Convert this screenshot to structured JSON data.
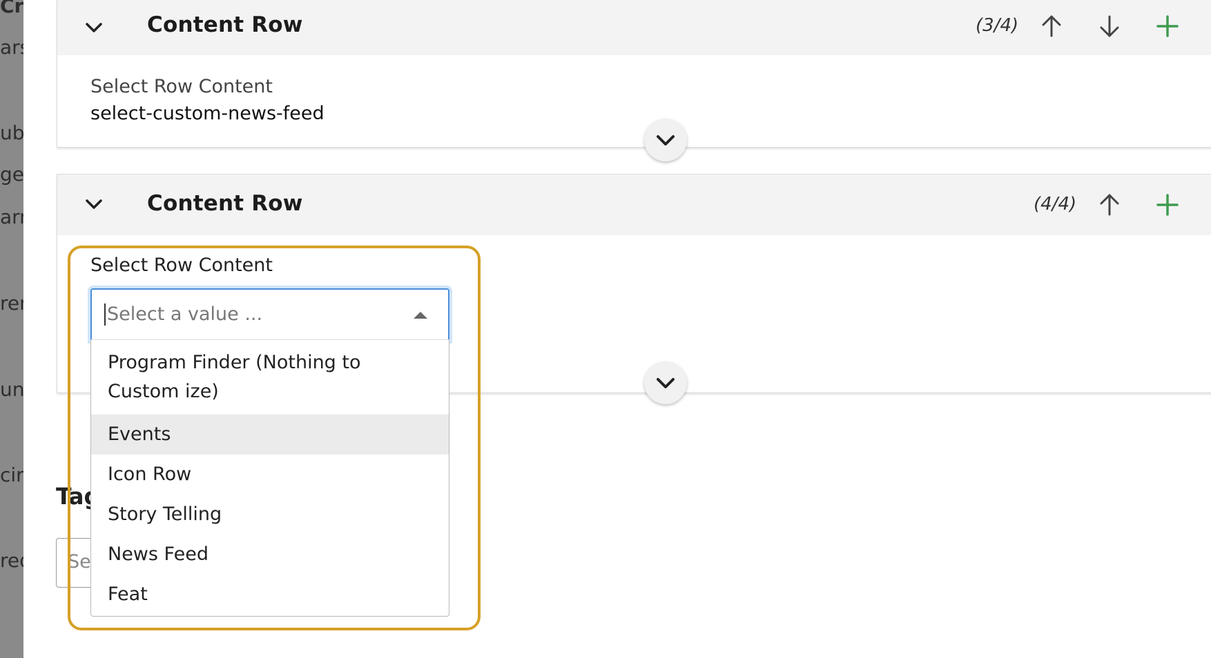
{
  "sidebar_fragments": [
    "Cre",
    "ars",
    "ubl",
    "ge",
    "arn",
    "ren",
    "unc",
    "cir",
    "red"
  ],
  "panels": [
    {
      "title": "Content Row",
      "counter": "(3/4)",
      "field_label": "Select Row Content",
      "field_value": "select-custom-news-feed"
    },
    {
      "title": "Content Row",
      "counter": "(4/4)"
    }
  ],
  "dropdown": {
    "label": "Select Row Content",
    "placeholder": "Select a value ...",
    "options": [
      "Program Finder (Nothing to Custom ize)",
      "Events",
      "Icon Row",
      "Story Telling",
      "News Feed",
      "Feat"
    ],
    "highlighted_option": "Events"
  },
  "tags": {
    "label": "Tag",
    "placeholder": "Se"
  },
  "colors": {
    "up_arrow": "#444444",
    "plus": "#3e9b4f",
    "close": "#e04b4b",
    "highlight_outline": "#d6a028",
    "focus_border": "#4a8fd8"
  }
}
